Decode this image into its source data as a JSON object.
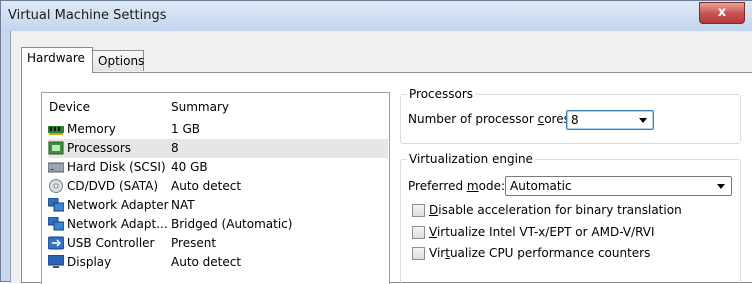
{
  "window": {
    "title": "Virtual Machine Settings",
    "close_glyph": "x"
  },
  "tabs": [
    {
      "label": "Hardware",
      "active": true
    },
    {
      "label": "Options",
      "active": false
    }
  ],
  "devices": {
    "headers": {
      "device": "Device",
      "summary": "Summary"
    },
    "rows": [
      {
        "device": "Memory",
        "summary": "1 GB",
        "icon": "memory-icon"
      },
      {
        "device": "Processors",
        "summary": "8",
        "icon": "processor-icon",
        "selected": true
      },
      {
        "device": "Hard Disk (SCSI)",
        "summary": "40 GB",
        "icon": "hard-disk-icon"
      },
      {
        "device": "CD/DVD (SATA)",
        "summary": "Auto detect",
        "icon": "cd-dvd-icon"
      },
      {
        "device": "Network Adapter",
        "summary": "NAT",
        "icon": "network-adapter-icon"
      },
      {
        "device": "Network Adapt...",
        "summary": "Bridged (Automatic)",
        "icon": "network-adapter-icon"
      },
      {
        "device": "USB Controller",
        "summary": "Present",
        "icon": "usb-icon"
      },
      {
        "device": "Display",
        "summary": "Auto detect",
        "icon": "display-icon"
      }
    ]
  },
  "processors": {
    "group_label": "Processors",
    "cores_label_pre": "Number of processor ",
    "cores_label_u": "c",
    "cores_label_post": "ores:",
    "cores_value": "8"
  },
  "virtualization": {
    "group_label": "Virtualization engine",
    "mode_label_pre": "Preferred ",
    "mode_label_u": "m",
    "mode_label_post": "ode:",
    "mode_value": "Automatic",
    "options": [
      {
        "pre": "",
        "u": "D",
        "post": "isable acceleration for binary translation",
        "checked": false
      },
      {
        "pre": "",
        "u": "V",
        "post": "irtualize Intel VT-x/EPT or AMD-V/RVI",
        "checked": false
      },
      {
        "pre": "Vir",
        "u": "t",
        "post": "ualize CPU performance counters",
        "checked": false
      }
    ]
  },
  "colors": {
    "titlebar": "#c3d6ee",
    "close": "#c75050",
    "selection": "#e6e6e6",
    "focus": "#3c7fb1"
  }
}
